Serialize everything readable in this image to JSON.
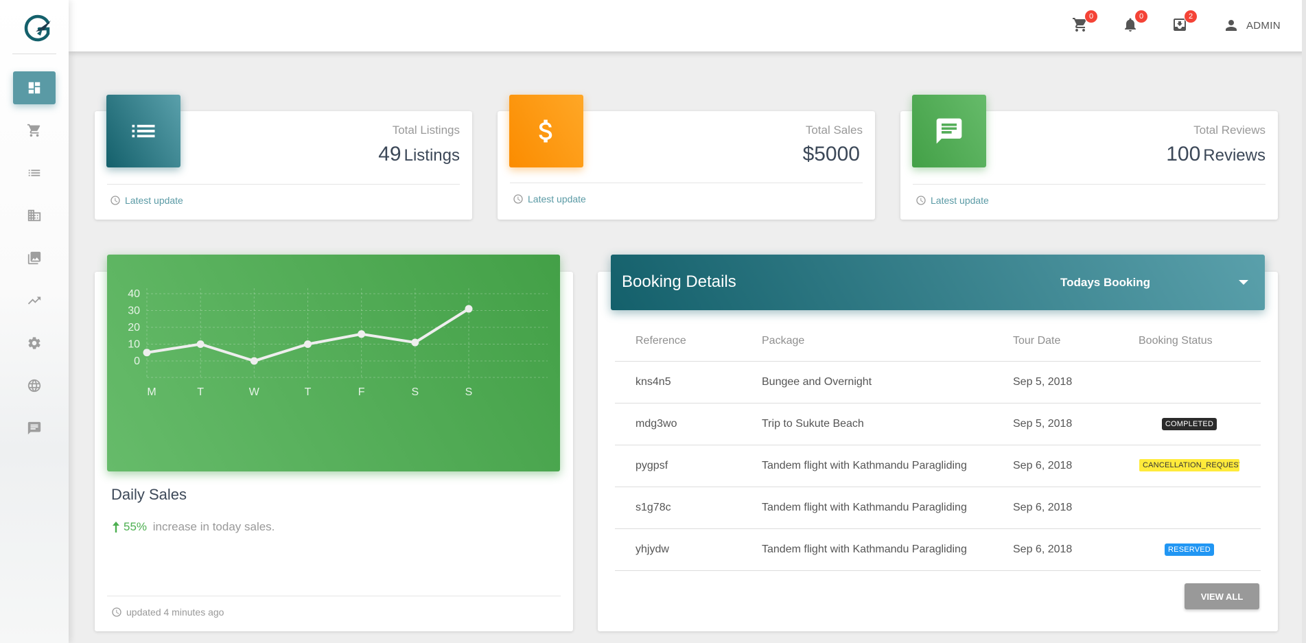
{
  "topbar": {
    "cart_count": "0",
    "notifications_count": "0",
    "messages_count": "2",
    "user_label": "ADMIN"
  },
  "sidebar": {
    "items": [
      {
        "icon": "dashboard-icon",
        "active": true
      },
      {
        "icon": "cart-icon"
      },
      {
        "icon": "list-icon"
      },
      {
        "icon": "building-icon"
      },
      {
        "icon": "photo-library-icon"
      },
      {
        "icon": "trending-up-icon"
      },
      {
        "icon": "gear-icon"
      },
      {
        "icon": "globe-icon"
      },
      {
        "icon": "chat-icon"
      }
    ]
  },
  "stats": [
    {
      "category": "Total Listings",
      "value": "49",
      "unit": "Listings",
      "footer": "Latest update",
      "icon": "list-icon",
      "color": "#14606b"
    },
    {
      "category": "Total Sales",
      "value": "$5000",
      "unit": "",
      "footer": "Latest update",
      "icon": "dollar-icon",
      "color": "#fb8c00"
    },
    {
      "category": "Total Reviews",
      "value": "100",
      "unit": "Reviews",
      "footer": "Latest update",
      "icon": "chat-icon",
      "color": "#43a047"
    }
  ],
  "daily_sales": {
    "title": "Daily Sales",
    "percent": "55%",
    "description": " increase in today sales.",
    "footer": "updated 4 minutes ago"
  },
  "chart_data": {
    "type": "line",
    "categories": [
      "M",
      "T",
      "W",
      "T",
      "F",
      "S",
      "S"
    ],
    "values": [
      5,
      10,
      0,
      10,
      16,
      11,
      31
    ],
    "ylim": [
      0,
      40
    ],
    "yticks": [
      0,
      10,
      20,
      30,
      40
    ],
    "grid": true,
    "line_color": "#eeeeee"
  },
  "booking": {
    "title": "Booking Details",
    "filter_selected": "Todays Booking",
    "columns": [
      "Reference",
      "Package",
      "Tour Date",
      "Booking Status"
    ],
    "rows": [
      {
        "reference": "kns4n5",
        "package": "Bungee and Overnight",
        "date": "Sep 5, 2018",
        "status": ""
      },
      {
        "reference": "mdg3wo",
        "package": "Trip to Sukute Beach",
        "date": "Sep 5, 2018",
        "status": "COMPLETED"
      },
      {
        "reference": "pygpsf",
        "package": "Tandem flight with Kathmandu Paragliding",
        "date": "Sep 6, 2018",
        "status": "CANCELLATION_REQUESTED"
      },
      {
        "reference": "s1g78c",
        "package": "Tandem flight with Kathmandu Paragliding",
        "date": "Sep 6, 2018",
        "status": ""
      },
      {
        "reference": "yhjydw",
        "package": "Tandem flight with Kathmandu Paragliding",
        "date": "Sep 6, 2018",
        "status": "RESERVED"
      }
    ],
    "view_all_label": "VIEW ALL"
  },
  "colors": {
    "primary": "#14606b",
    "accent": "#5a9aa5",
    "warning": "#fb8c00",
    "success": "#43a047",
    "danger": "#f44336",
    "info": "#2196f3"
  }
}
